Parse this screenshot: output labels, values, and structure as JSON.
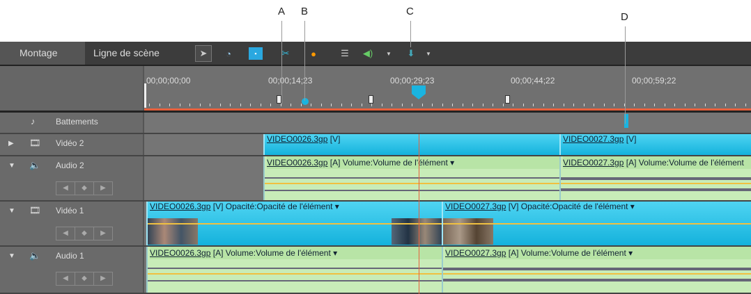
{
  "callouts": [
    "A",
    "B",
    "C",
    "D"
  ],
  "toolbar": {
    "tabs": [
      "Montage",
      "Ligne de scène"
    ],
    "icons": [
      "selection-tool-icon",
      "time-stretch-icon",
      "smart-fit-icon",
      "split-clip-icon",
      "smart-mix-icon",
      "markers-list-icon",
      "volume-icon",
      "marker-icon"
    ]
  },
  "ruler": {
    "timecodes": [
      "00;00;00;00",
      "00;00;14;23",
      "00;00;29;23",
      "00;00;44;22",
      "00;00;59;22"
    ]
  },
  "tracks": {
    "beats": {
      "name": "Battements"
    },
    "video2": {
      "name": "Vidéo 2",
      "clips": [
        {
          "file": "VIDEO0026.3gp",
          "tag": "[V]"
        },
        {
          "file": "VIDEO0027.3gp",
          "tag": "[V]"
        }
      ]
    },
    "audio2": {
      "name": "Audio 2",
      "clips": [
        {
          "file": "VIDEO0026.3gp",
          "tag": "[A]",
          "prop": "Volume:Volume de l'élément ▾"
        },
        {
          "file": "VIDEO0027.3gp",
          "tag": "[A]",
          "prop": "Volume:Volume de l'élément"
        }
      ]
    },
    "video1": {
      "name": "Vidéo 1",
      "clips": [
        {
          "file": "VIDEO0026.3gp",
          "tag": "[V]",
          "prop": "Opacité:Opacité de l'élément ▾"
        },
        {
          "file": "VIDEO0027.3gp",
          "tag": "[V]",
          "prop": "Opacité:Opacité de l'élément ▾"
        }
      ]
    },
    "audio1": {
      "name": "Audio 1",
      "clips": [
        {
          "file": "VIDEO0026.3gp",
          "tag": "[A]",
          "prop": "Volume:Volume de l'élément ▾"
        },
        {
          "file": "VIDEO0027.3gp",
          "tag": "[A]",
          "prop": "Volume:Volume de l'élément ▾"
        }
      ]
    }
  },
  "colors": {
    "video": "#1ebde4",
    "audio": "#c8ecb8",
    "playhead": "#e8603c"
  }
}
